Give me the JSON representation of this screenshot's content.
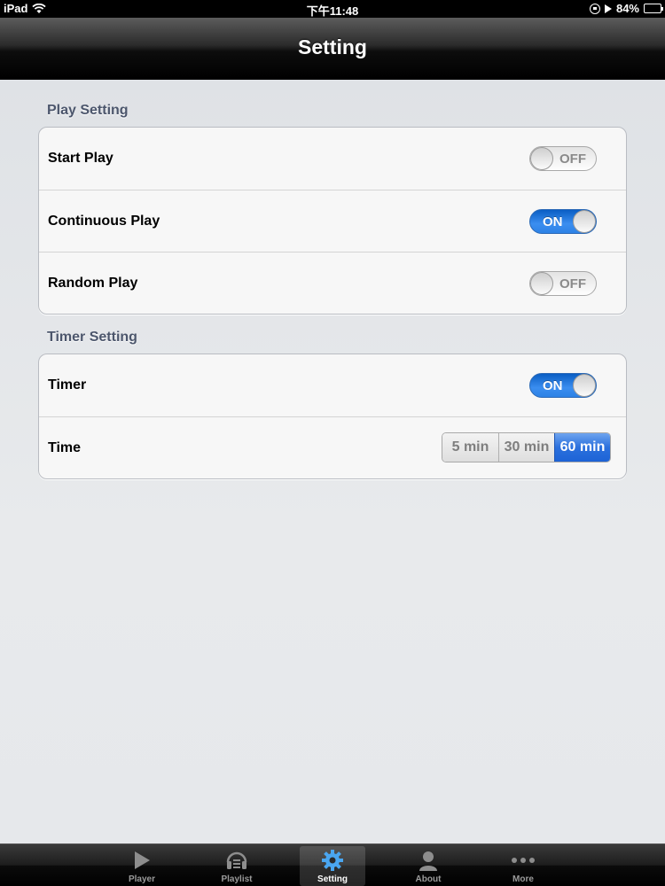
{
  "status_bar": {
    "device": "iPad",
    "time": "下午11:48",
    "battery": "84%",
    "battery_level": 0.84
  },
  "navbar": {
    "title": "Setting"
  },
  "play_setting": {
    "header": "Play Setting",
    "rows": [
      {
        "label": "Start Play",
        "switch_text": "OFF",
        "state": "off"
      },
      {
        "label": "Continuous Play",
        "switch_text": "ON",
        "state": "on"
      },
      {
        "label": "Random Play",
        "switch_text": "OFF",
        "state": "off"
      }
    ]
  },
  "timer_setting": {
    "header": "Timer Setting",
    "timer": {
      "label": "Timer",
      "switch_text": "ON",
      "state": "on"
    },
    "time": {
      "label": "Time",
      "options": [
        "5 min",
        "30 min",
        "60 min"
      ],
      "selected": "60 min"
    }
  },
  "tabbar": {
    "tabs": [
      {
        "label": "Player",
        "icon": "play-icon",
        "active": false
      },
      {
        "label": "Playlist",
        "icon": "playlist-icon",
        "active": false
      },
      {
        "label": "Setting",
        "icon": "gear-icon",
        "active": true
      },
      {
        "label": "About",
        "icon": "person-icon",
        "active": false
      },
      {
        "label": "More",
        "icon": "more-icon",
        "active": false
      }
    ]
  },
  "colors": {
    "switch_on": "#2d82e6",
    "segment_selected": "#2b70dd",
    "active_tab_icon": "#4aa6f0"
  }
}
